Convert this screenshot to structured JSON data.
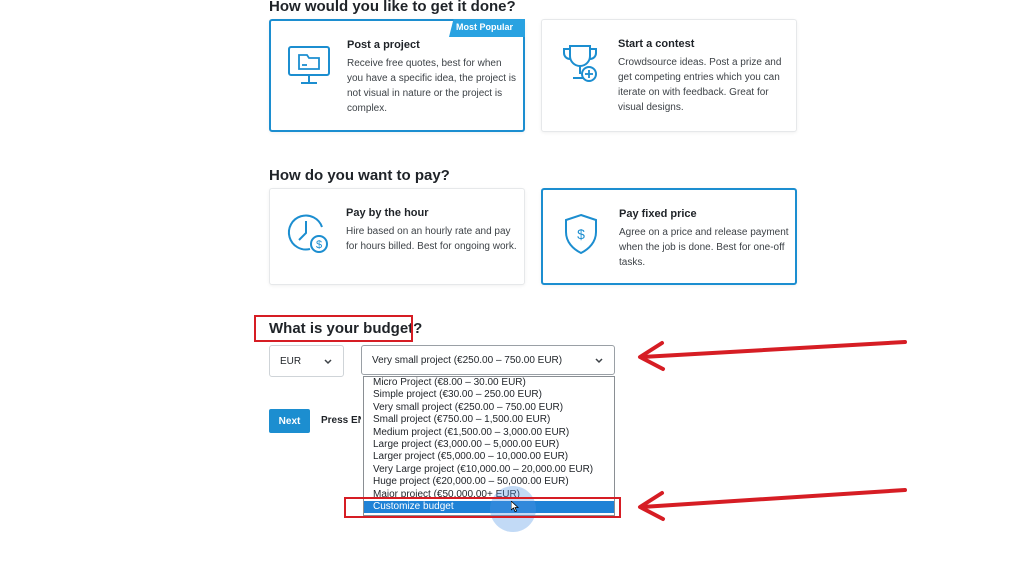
{
  "section_method": {
    "heading": "How would you like to get it done?",
    "cards": [
      {
        "title": "Post a project",
        "description": "Receive free quotes, best for when you have a specific idea, the project is not visual in nature or the project is complex.",
        "badge": "Most Popular",
        "icon": "monitor-icon",
        "selected": true
      },
      {
        "title": "Start a contest",
        "description": "Crowdsource ideas. Post a prize and get competing entries which you can iterate on with feedback. Great for visual designs.",
        "icon": "trophy-icon",
        "selected": false
      }
    ]
  },
  "section_pay": {
    "heading": "How do you want to pay?",
    "cards": [
      {
        "title": "Pay by the hour",
        "description": "Hire based on an hourly rate and pay for hours billed. Best for ongoing work.",
        "icon": "clock-dollar-icon",
        "selected": false
      },
      {
        "title": "Pay fixed price",
        "description": "Agree on a price and release payment when the job is done. Best for one-off tasks.",
        "icon": "shield-dollar-icon",
        "selected": true
      }
    ]
  },
  "section_budget": {
    "heading": "What is your budget?",
    "currency": "EUR",
    "selected_budget": "Very small project (€250.00 – 750.00 EUR)",
    "options": [
      "Micro Project (€8.00 – 30.00 EUR)",
      "Simple project (€30.00 – 250.00 EUR)",
      "Very small project (€250.00 – 750.00 EUR)",
      "Small project (€750.00 – 1,500.00 EUR)",
      "Medium project (€1,500.00 – 3,000.00 EUR)",
      "Large project (€3,000.00 – 5,000.00 EUR)",
      "Larger project (€5,000.00 – 10,000.00 EUR)",
      "Very Large project (€10,000.00 – 20,000.00 EUR)",
      "Huge project (€20,000.00 – 50,000.00 EUR)",
      "Major project (€50,000.00+ EUR)",
      "Customize budget"
    ],
    "highlighted_option": "Customize budget"
  },
  "actions": {
    "next_label": "Next",
    "press_enter_label": "Press ENTER"
  },
  "annotation_colors": {
    "red": "#d61d24",
    "accent": "#1c8ed0"
  }
}
